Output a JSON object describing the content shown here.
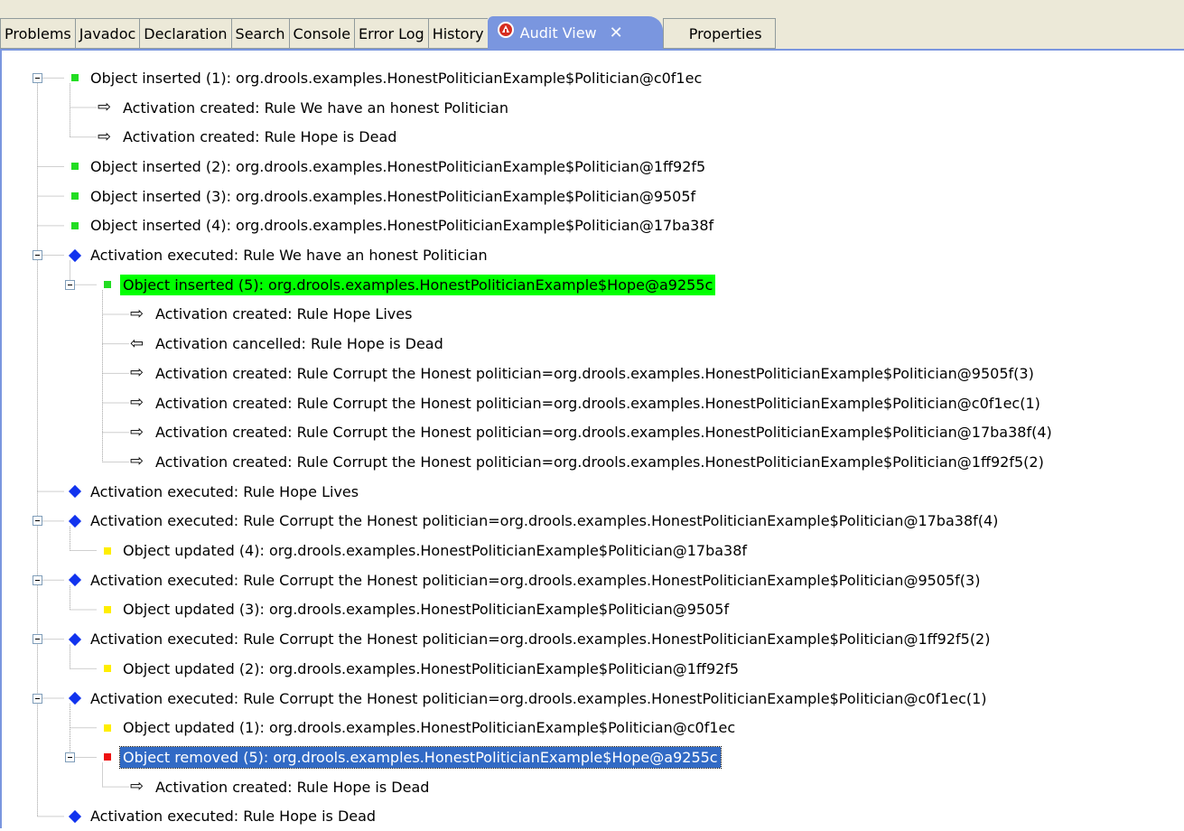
{
  "tabs": [
    "Problems",
    "Javadoc",
    "Declaration",
    "Search",
    "Console",
    "Error Log",
    "History",
    "Audit View",
    "Properties"
  ],
  "active_tab": "Audit View",
  "close_glyph": "✕",
  "colors": {
    "accent": "#7a96df",
    "selection": "#316ac5",
    "highlight": "#00ff00"
  },
  "tree": [
    {
      "level": 0,
      "expander": true,
      "icon": "object-inserted-icon",
      "text": "Object inserted (1): org.drools.examples.HonestPoliticianExample$Politician@c0f1ec"
    },
    {
      "level": 1,
      "expander": false,
      "icon": "activation-created-icon",
      "text": "Activation created: Rule We have an honest Politician"
    },
    {
      "level": 1,
      "expander": false,
      "icon": "activation-created-icon",
      "text": "Activation created: Rule Hope is Dead"
    },
    {
      "level": 0,
      "expander": false,
      "icon": "object-inserted-icon",
      "text": "Object inserted (2): org.drools.examples.HonestPoliticianExample$Politician@1ff92f5"
    },
    {
      "level": 0,
      "expander": false,
      "icon": "object-inserted-icon",
      "text": "Object inserted (3): org.drools.examples.HonestPoliticianExample$Politician@9505f"
    },
    {
      "level": 0,
      "expander": false,
      "icon": "object-inserted-icon",
      "text": "Object inserted (4): org.drools.examples.HonestPoliticianExample$Politician@17ba38f"
    },
    {
      "level": 0,
      "expander": true,
      "icon": "activation-executed-icon",
      "text": "Activation executed: Rule We have an honest Politician"
    },
    {
      "level": 1,
      "expander": true,
      "icon": "object-inserted-icon",
      "text": "Object inserted (5): org.drools.examples.HonestPoliticianExample$Hope@a9255c",
      "highlight": "green"
    },
    {
      "level": 2,
      "expander": false,
      "icon": "activation-created-icon",
      "text": "Activation created: Rule Hope Lives"
    },
    {
      "level": 2,
      "expander": false,
      "icon": "activation-cancelled-icon",
      "text": "Activation cancelled: Rule Hope is Dead"
    },
    {
      "level": 2,
      "expander": false,
      "icon": "activation-created-icon",
      "text": "Activation created: Rule Corrupt the Honest politician=org.drools.examples.HonestPoliticianExample$Politician@9505f(3)"
    },
    {
      "level": 2,
      "expander": false,
      "icon": "activation-created-icon",
      "text": "Activation created: Rule Corrupt the Honest politician=org.drools.examples.HonestPoliticianExample$Politician@c0f1ec(1)"
    },
    {
      "level": 2,
      "expander": false,
      "icon": "activation-created-icon",
      "text": "Activation created: Rule Corrupt the Honest politician=org.drools.examples.HonestPoliticianExample$Politician@17ba38f(4)"
    },
    {
      "level": 2,
      "expander": false,
      "icon": "activation-created-icon",
      "text": "Activation created: Rule Corrupt the Honest politician=org.drools.examples.HonestPoliticianExample$Politician@1ff92f5(2)"
    },
    {
      "level": 0,
      "expander": false,
      "icon": "activation-executed-icon",
      "text": "Activation executed: Rule Hope Lives"
    },
    {
      "level": 0,
      "expander": true,
      "icon": "activation-executed-icon",
      "text": "Activation executed: Rule Corrupt the Honest politician=org.drools.examples.HonestPoliticianExample$Politician@17ba38f(4)"
    },
    {
      "level": 1,
      "expander": false,
      "icon": "object-updated-icon",
      "text": "Object updated (4): org.drools.examples.HonestPoliticianExample$Politician@17ba38f"
    },
    {
      "level": 0,
      "expander": true,
      "icon": "activation-executed-icon",
      "text": "Activation executed: Rule Corrupt the Honest politician=org.drools.examples.HonestPoliticianExample$Politician@9505f(3)"
    },
    {
      "level": 1,
      "expander": false,
      "icon": "object-updated-icon",
      "text": "Object updated (3): org.drools.examples.HonestPoliticianExample$Politician@9505f"
    },
    {
      "level": 0,
      "expander": true,
      "icon": "activation-executed-icon",
      "text": "Activation executed: Rule Corrupt the Honest politician=org.drools.examples.HonestPoliticianExample$Politician@1ff92f5(2)"
    },
    {
      "level": 1,
      "expander": false,
      "icon": "object-updated-icon",
      "text": "Object updated (2): org.drools.examples.HonestPoliticianExample$Politician@1ff92f5"
    },
    {
      "level": 0,
      "expander": true,
      "icon": "activation-executed-icon",
      "text": "Activation executed: Rule Corrupt the Honest politician=org.drools.examples.HonestPoliticianExample$Politician@c0f1ec(1)"
    },
    {
      "level": 1,
      "expander": false,
      "icon": "object-updated-icon",
      "text": "Object updated (1): org.drools.examples.HonestPoliticianExample$Politician@c0f1ec"
    },
    {
      "level": 1,
      "expander": true,
      "icon": "object-removed-icon",
      "text": "Object removed (5): org.drools.examples.HonestPoliticianExample$Hope@a9255c",
      "highlight": "selected"
    },
    {
      "level": 2,
      "expander": false,
      "icon": "activation-created-icon",
      "text": "Activation created: Rule Hope is Dead"
    },
    {
      "level": 0,
      "expander": false,
      "icon": "activation-executed-icon",
      "text": "Activation executed: Rule Hope is Dead"
    }
  ]
}
